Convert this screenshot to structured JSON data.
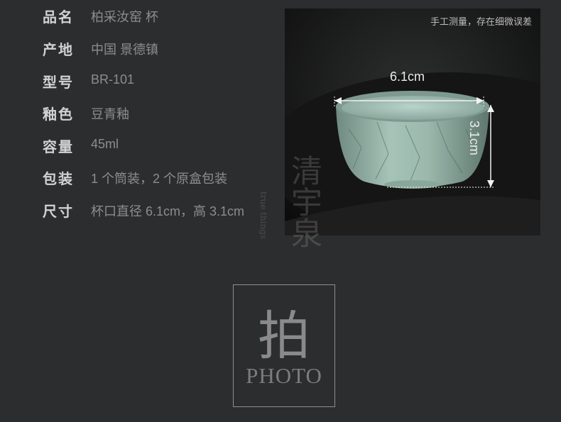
{
  "specs": [
    {
      "label": "品名",
      "value": "柏采汝窑 杯"
    },
    {
      "label": "产地",
      "value": "中国 景德镇"
    },
    {
      "label": "型号",
      "value": "BR-101"
    },
    {
      "label": "釉色",
      "value": "豆青釉"
    },
    {
      "label": "容量",
      "value": "45ml"
    },
    {
      "label": "包装",
      "value": "1 个筒装，2 个原盒包装"
    },
    {
      "label": "尺寸",
      "value": "杯口直径 6.1cm，高 3.1cm"
    }
  ],
  "photo": {
    "caption": "手工测量，存在细微误差",
    "width_label": "6.1cm",
    "height_label": "3.1cm"
  },
  "watermark": {
    "text": "清宇泉",
    "side_text": "true things"
  },
  "stamp": {
    "char": "拍",
    "text": "PHOTO"
  },
  "colors": {
    "background": "#2b2d2f",
    "label": "#d2d2d2",
    "value": "#8b8d8f",
    "glaze": "#9bb8ad"
  }
}
